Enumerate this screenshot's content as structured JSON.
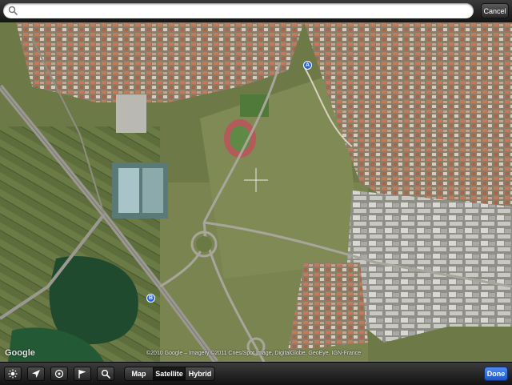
{
  "search": {
    "placeholder": "",
    "value": "",
    "icon": "search-icon"
  },
  "top": {
    "cancel_label": "Cancel"
  },
  "map": {
    "logo_text": "Google",
    "copyright": "©2010 Google – Imagery ©2011 Cnes/Spot Image, DigitalGlobe, GeoEye, IGN-France",
    "pins": [
      {
        "label": "A",
        "color": "#2b62e0"
      },
      {
        "label": "B",
        "color": "#2b62e0"
      }
    ]
  },
  "toolbar": {
    "icons": [
      "brightness-icon",
      "location-arrow-icon",
      "target-icon",
      "flag-icon",
      "search-icon"
    ],
    "segments": [
      "Map",
      "Satellite",
      "Hybrid"
    ],
    "selected": "Satellite",
    "done_label": "Done"
  },
  "colors": {
    "accent": "#2b62e0",
    "done": "#2f6ee0"
  }
}
